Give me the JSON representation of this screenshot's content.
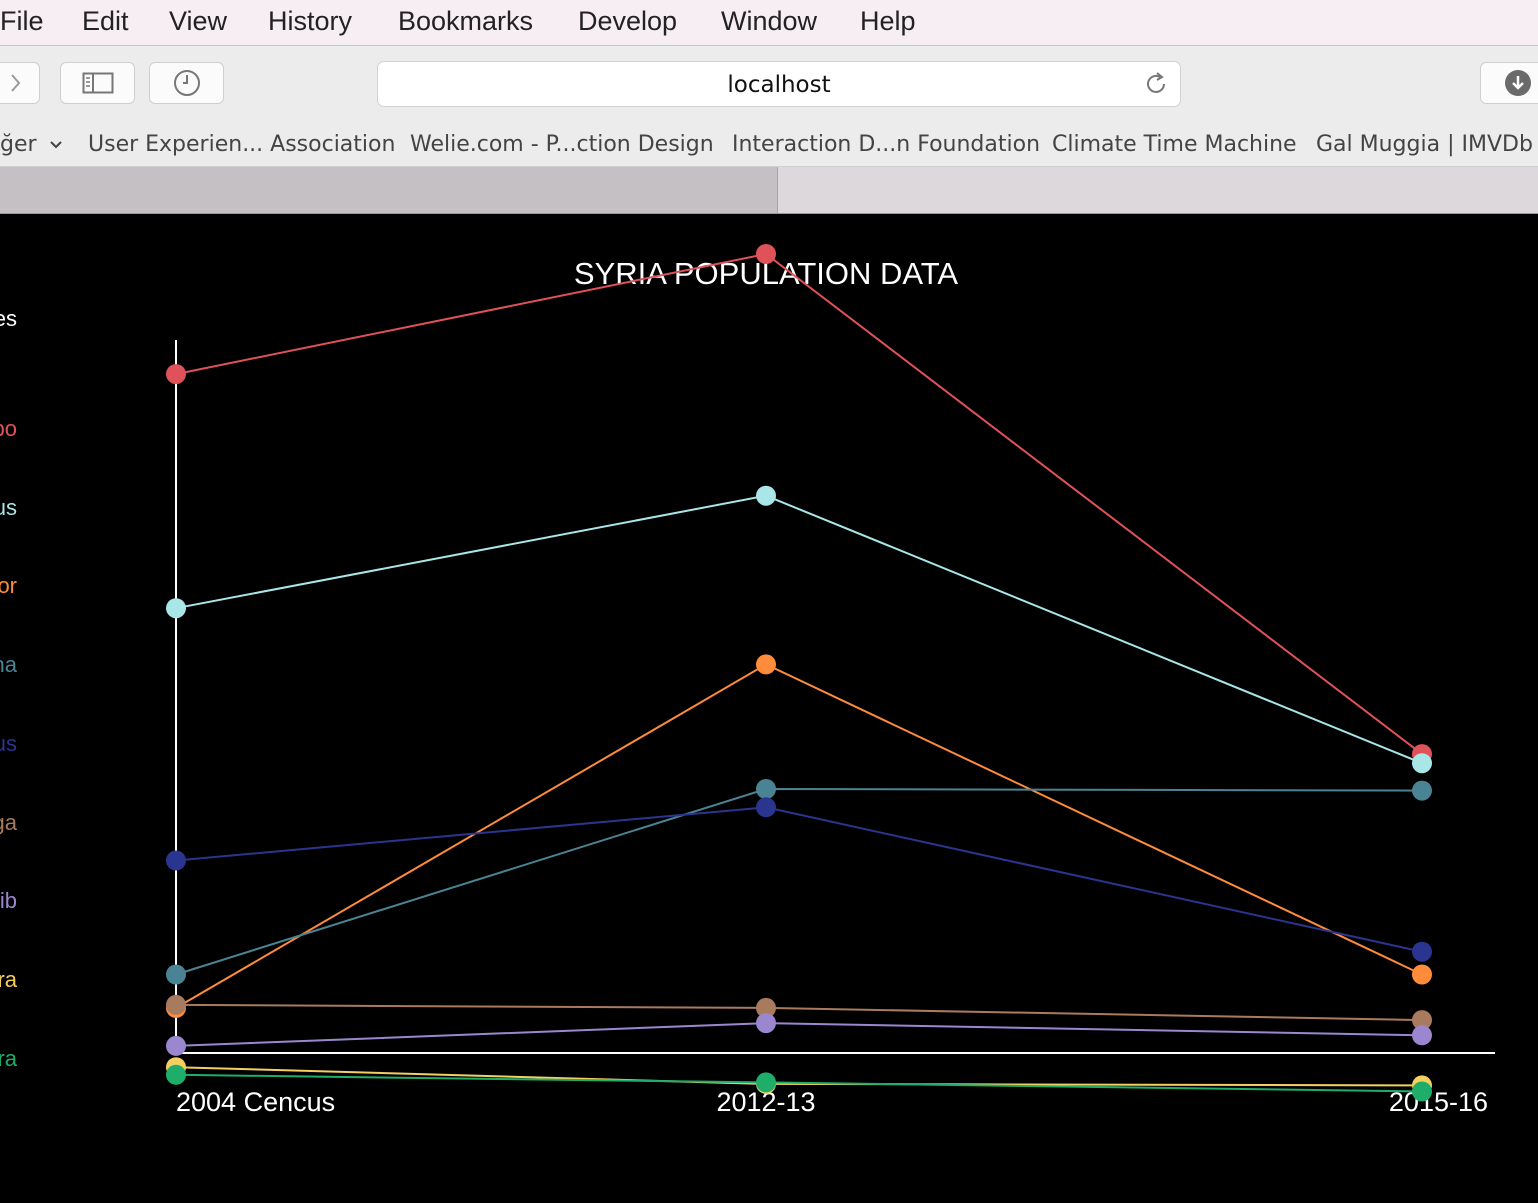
{
  "menubar": {
    "items": [
      "File",
      "Edit",
      "View",
      "History",
      "Bookmarks",
      "Develop",
      "Window",
      "Help"
    ]
  },
  "toolbar": {
    "forward_icon": "chevron-right-icon",
    "sidebar_icon": "sidebar-icon",
    "history_icon": "clock-icon",
    "url": "localhost",
    "reload_icon": "reload-icon",
    "download_icon": "download-icon"
  },
  "bookmarks": {
    "items": [
      "ğer",
      "User Experien... Association",
      "Welie.com - P...ction Design",
      "Interaction D...n Foundation",
      "Climate Time Machine",
      "Gal Muggia | IMVDb"
    ]
  },
  "legend": {
    "header": "es",
    "items": [
      {
        "text": "po",
        "color": "#e0525a"
      },
      {
        "text": "us",
        "color": "#a8e6e8"
      },
      {
        "text": "or",
        "color": "#ff8c3a"
      },
      {
        "text": "na",
        "color": "#4a8494"
      },
      {
        "text": "us",
        "color": "#2a3590"
      },
      {
        "text": "ga",
        "color": "#a87a5e"
      },
      {
        "text": "lib",
        "color": "#9b87d0"
      },
      {
        "text": "ra",
        "color": "#f4d060"
      },
      {
        "text": "ra",
        "color": "#1fae6a"
      }
    ]
  },
  "chart_data": {
    "type": "line",
    "title": "SYRIA POPULATION DATA",
    "categories": [
      "2004 Cencus",
      "2012-13",
      "2015-16"
    ],
    "series": [
      {
        "color": "#e0525a",
        "values": [
          4.46,
          5.25,
          1.96
        ]
      },
      {
        "color": "#a8e6e8",
        "values": [
          2.92,
          3.66,
          1.9
        ]
      },
      {
        "color": "#ff8c3a",
        "values": [
          0.29,
          2.55,
          0.51
        ]
      },
      {
        "color": "#4a8494",
        "values": [
          0.51,
          1.73,
          1.72
        ]
      },
      {
        "color": "#2a3590",
        "values": [
          1.26,
          1.61,
          0.66
        ]
      },
      {
        "color": "#a87a5e",
        "values": [
          0.31,
          0.29,
          0.21
        ]
      },
      {
        "color": "#9b87d0",
        "values": [
          0.04,
          0.19,
          0.11
        ]
      },
      {
        "color": "#f4d060",
        "values": [
          -0.1,
          -0.21,
          -0.22
        ]
      },
      {
        "color": "#1fae6a",
        "values": [
          -0.15,
          -0.2,
          -0.26
        ]
      }
    ]
  }
}
